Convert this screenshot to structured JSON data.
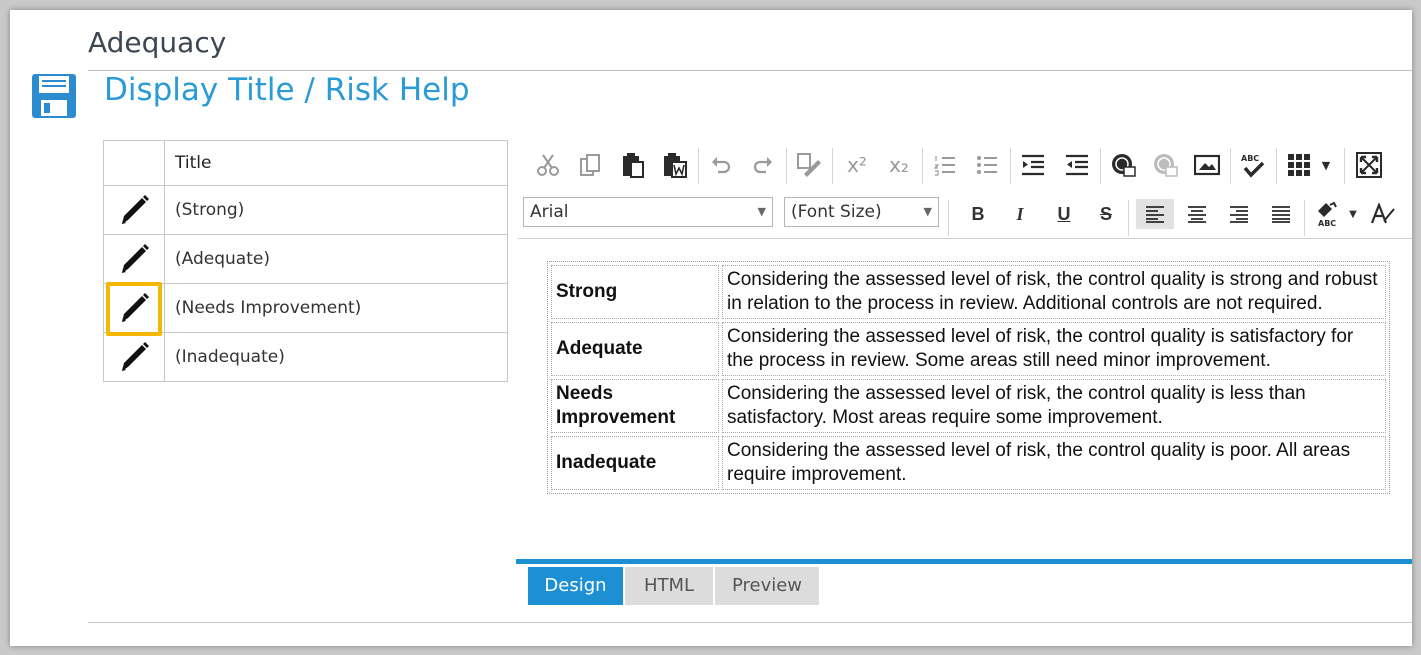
{
  "header": {
    "section_title": "Adequacy",
    "page_title": "Display Title / Risk Help"
  },
  "grid": {
    "column_title": "Title",
    "rows": [
      {
        "title": "(Strong)",
        "highlighted": false
      },
      {
        "title": "(Adequate)",
        "highlighted": false
      },
      {
        "title": "(Needs Improvement)",
        "highlighted": true
      },
      {
        "title": "(Inadequate)",
        "highlighted": false
      }
    ],
    "highlight_color": "#f5b800"
  },
  "editor": {
    "font_select": "Arial",
    "size_select": "(Font Size)",
    "toolbar_icons_row1": [
      "cut-icon",
      "copy-icon",
      "paste-icon",
      "paste-from-word-icon",
      "undo-icon",
      "redo-icon",
      "paste-plain-icon",
      "superscript-icon",
      "subscript-icon",
      "numbered-list-icon",
      "bulleted-list-icon",
      "indent-icon",
      "outdent-icon",
      "insert-link-icon",
      "remove-link-icon",
      "insert-image-icon",
      "spellcheck-icon",
      "insert-table-icon",
      "table-dropdown-icon",
      "fullscreen-icon"
    ],
    "toolbar_icons_row2": [
      "bold-icon",
      "italic-icon",
      "underline-icon",
      "strikethrough-icon",
      "align-left-icon",
      "align-center-icon",
      "align-right-icon",
      "justify-icon",
      "format-painter-icon",
      "format-dropdown-icon",
      "clear-format-icon"
    ],
    "format_labels": {
      "bold": "B",
      "italic": "I",
      "underline": "U",
      "strike": "S"
    },
    "superscript_label": "x²",
    "subscript_label": "x₂",
    "content_rows": [
      {
        "label": "Strong",
        "text": "Considering the assessed level of risk, the control quality is strong and robust in relation to the process in review. Additional controls are not required."
      },
      {
        "label": "Adequate",
        "text": "Considering the assessed level of risk, the control quality is satisfactory for the process in review. Some areas still need minor improvement."
      },
      {
        "label": "Needs Improvement",
        "text": "Considering the assessed level of risk, the control quality is less than satisfactory. Most areas require some improvement."
      },
      {
        "label": "Inadequate",
        "text": "Considering the assessed level of risk, the control quality is poor. All areas require improvement."
      }
    ]
  },
  "tabs": [
    {
      "label": "Design",
      "active": true
    },
    {
      "label": "HTML",
      "active": false
    },
    {
      "label": "Preview",
      "active": false
    }
  ],
  "colors": {
    "accent": "#1d90d4",
    "title_blue": "#2b9bd6"
  }
}
